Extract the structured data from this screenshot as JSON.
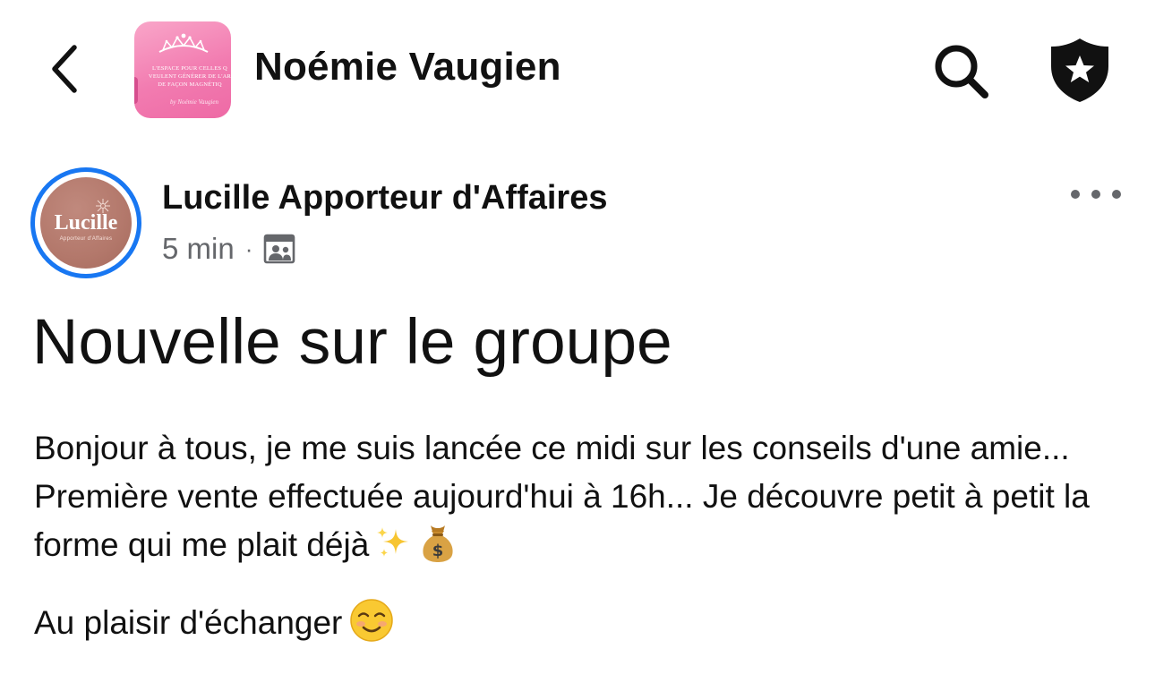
{
  "header": {
    "group_name": "Noémie Vaugien",
    "back_icon": "chevron-left-icon",
    "search_icon": "search-icon",
    "shield_icon": "shield-star-icon",
    "thumbnail": {
      "text": "L'ESPACE POUR CELLES Q\nVEULENT GÉNÉRER DE L'AR\nDE FAÇON MAGNÉTIQ",
      "signature": "by Noémie Vaugien",
      "background": "#f27bb0"
    }
  },
  "post": {
    "author": "Lucille Apporteur d'Affaires",
    "avatar": {
      "name": "Lucille",
      "subtitle": "Apporteur d'Affaires",
      "ring_color": "#1877f2",
      "background": "#b3786b"
    },
    "time": "5 min",
    "separator": "·",
    "audience_icon": "group-icon",
    "more_icon": "more-horizontal-icon",
    "title": "Nouvelle sur le groupe",
    "body": "Bonjour à tous, je me suis lancée ce midi sur les conseils d'une amie... Première vente effectuée aujourd'hui à 16h... Je découvre petit à petit la forme qui me plait déjà",
    "body_emojis": [
      "sparkles-emoji",
      "money-bag-emoji"
    ],
    "closing": "Au plaisir d'échanger",
    "closing_emoji": "smiling-face-emoji"
  },
  "colors": {
    "text": "#111111",
    "meta": "#65676b",
    "accent": "#1877f2"
  }
}
